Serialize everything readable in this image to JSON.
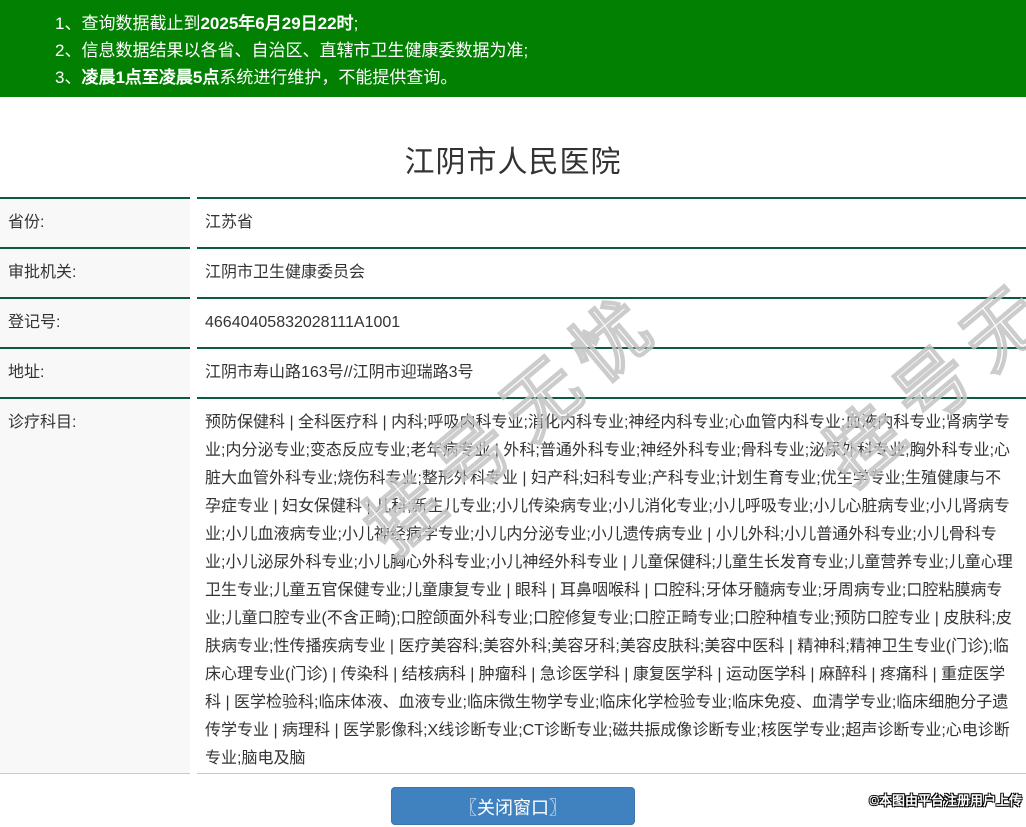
{
  "notices": {
    "items": [
      {
        "num": "1、",
        "pre": "查询数据截止到",
        "bold": "2025年6月29日22时",
        "post": ";"
      },
      {
        "num": "2、",
        "pre": "信息数据结果以各省、自治区、直辖市卫生健康委数据为准;",
        "bold": "",
        "post": ""
      },
      {
        "num": "3、",
        "pre": "",
        "bold": "凌晨1点至凌晨5点",
        "post": "系统进行维护，不能提供查询。"
      }
    ]
  },
  "hospital": {
    "title": "江阴市人民医院",
    "fields": [
      {
        "label": "省份:",
        "value": "江苏省"
      },
      {
        "label": "审批机关:",
        "value": "江阴市卫生健康委员会"
      },
      {
        "label": "登记号:",
        "value": "46640405832028111A1001"
      },
      {
        "label": "地址:",
        "value": "江阴市寿山路163号//江阴市迎瑞路3号"
      },
      {
        "label": "诊疗科目:",
        "value": "预防保健科 | 全科医疗科 | 内科;呼吸内科专业;消化内科专业;神经内科专业;心血管内科专业;血液内科专业;肾病学专业;内分泌专业;变态反应专业;老年病专业 | 外科;普通外科专业;神经外科专业;骨科专业;泌尿外科专业;胸外科专业;心脏大血管外科专业;烧伤科专业;整形外科专业 | 妇产科;妇科专业;产科专业;计划生育专业;优生学专业;生殖健康与不孕症专业 | 妇女保健科 | 儿科;新生儿专业;小儿传染病专业;小儿消化专业;小儿呼吸专业;小儿心脏病专业;小儿肾病专业;小儿血液病专业;小儿神经病学专业;小儿内分泌专业;小儿遗传病专业 | 小儿外科;小儿普通外科专业;小儿骨科专业;小儿泌尿外科专业;小儿胸心外科专业;小儿神经外科专业 | 儿童保健科;儿童生长发育专业;儿童营养专业;儿童心理卫生专业;儿童五官保健专业;儿童康复专业 | 眼科 | 耳鼻咽喉科 | 口腔科;牙体牙髓病专业;牙周病专业;口腔粘膜病专业;儿童口腔专业(不含正畸);口腔颌面外科专业;口腔修复专业;口腔正畸专业;口腔种植专业;预防口腔专业 | 皮肤科;皮肤病专业;性传播疾病专业 | 医疗美容科;美容外科;美容牙科;美容皮肤科;美容中医科 | 精神科;精神卫生专业(门诊);临床心理专业(门诊) | 传染科 | 结核病科 | 肿瘤科 | 急诊医学科 | 康复医学科 | 运动医学科 | 麻醉科 | 疼痛科 | 重症医学科 | 医学检验科;临床体液、血液专业;临床微生物学专业;临床化学检验专业;临床免疫、血清学专业;临床细胞分子遗传学专业 | 病理科 | 医学影像科;X线诊断专业;CT诊断专业;磁共振成像诊断专业;核医学专业;超声诊断专业;心电诊断专业;脑电及脑"
      }
    ]
  },
  "watermark_text": "挂号无忧",
  "close_button_label": "〖关闭窗口〗",
  "copyright_text": "©本图由平台注册用户上传",
  "colors": {
    "header_green": "#018001",
    "divider_green": "#0c5c3c",
    "button_blue": "#4081bf",
    "label_bg": "#f8f8f8"
  }
}
